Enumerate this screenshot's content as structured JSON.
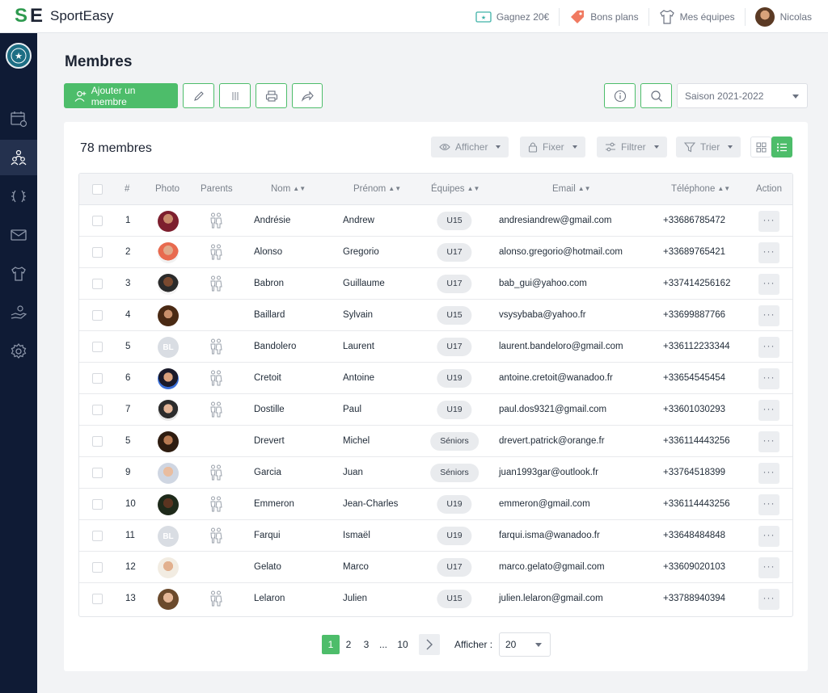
{
  "brand": {
    "name": "SportEasy"
  },
  "topbar": {
    "links": [
      {
        "label": "Gagnez 20€",
        "icon": "ticket-icon"
      },
      {
        "label": "Bons plans",
        "icon": "tag-icon"
      },
      {
        "label": "Mes équipes",
        "icon": "jersey-icon"
      }
    ],
    "user": {
      "name": "Nicolas"
    }
  },
  "sidebar": {
    "items": [
      {
        "icon": "calendar-icon",
        "active": false
      },
      {
        "icon": "members-icon",
        "active": true
      },
      {
        "icon": "laurel-icon",
        "active": false
      },
      {
        "icon": "mail-icon",
        "active": false
      },
      {
        "icon": "shirt-icon",
        "active": false
      },
      {
        "icon": "hand-coin-icon",
        "active": false
      },
      {
        "icon": "gear-icon",
        "active": false
      }
    ]
  },
  "page": {
    "title": "Membres",
    "add_label": "Ajouter un membre",
    "season": "Saison 2021-2022"
  },
  "list": {
    "count_label": "78 membres",
    "tools": {
      "show": "Afficher",
      "pin": "Fixer",
      "filter": "Filtrer",
      "sort": "Trier"
    }
  },
  "table": {
    "columns": {
      "num": "#",
      "photo": "Photo",
      "parents": "Parents",
      "nom": "Nom",
      "prenom": "Prénom",
      "equipes": "Équipes",
      "email": "Email",
      "telephone": "Téléphone",
      "action": "Action"
    },
    "rows": [
      {
        "num": "1",
        "nom": "Andrésie",
        "prenom": "Andrew",
        "equipe": "U15",
        "email": "andresiandrew@gmail.com",
        "tel": "+33686785472",
        "parents": true,
        "initials": ""
      },
      {
        "num": "2",
        "nom": "Alonso",
        "prenom": "Gregorio",
        "equipe": "U17",
        "email": "alonso.gregorio@hotmail.com",
        "tel": "+33689765421",
        "parents": true,
        "initials": ""
      },
      {
        "num": "3",
        "nom": "Babron",
        "prenom": "Guillaume",
        "equipe": "U17",
        "email": "bab_gui@yahoo.com",
        "tel": "+337414256162",
        "parents": true,
        "initials": ""
      },
      {
        "num": "4",
        "nom": "Baillard",
        "prenom": "Sylvain",
        "equipe": "U15",
        "email": "vsysybaba@yahoo.fr",
        "tel": "+33699887766",
        "parents": false,
        "initials": ""
      },
      {
        "num": "5",
        "nom": "Bandolero",
        "prenom": "Laurent",
        "equipe": "U17",
        "email": "laurent.bandeloro@gmail.com",
        "tel": "+336112233344",
        "parents": true,
        "initials": "BL"
      },
      {
        "num": "6",
        "nom": "Cretoit",
        "prenom": "Antoine",
        "equipe": "U19",
        "email": "antoine.cretoit@wanadoo.fr",
        "tel": "+33654545454",
        "parents": true,
        "initials": ""
      },
      {
        "num": "7",
        "nom": "Dostille",
        "prenom": "Paul",
        "equipe": "U19",
        "email": "paul.dos9321@gmail.com",
        "tel": "+33601030293",
        "parents": true,
        "initials": ""
      },
      {
        "num": "5",
        "nom": "Drevert",
        "prenom": "Michel",
        "equipe": "Séniors",
        "email": "drevert.patrick@orange.fr",
        "tel": "+336114443256",
        "parents": false,
        "initials": ""
      },
      {
        "num": "9",
        "nom": "Garcia",
        "prenom": "Juan",
        "equipe": "Séniors",
        "email": "juan1993gar@outlook.fr",
        "tel": "+33764518399",
        "parents": true,
        "initials": ""
      },
      {
        "num": "10",
        "nom": "Emmeron",
        "prenom": "Jean-Charles",
        "equipe": "U19",
        "email": "emmeron@gmail.com",
        "tel": "+336114443256",
        "parents": true,
        "initials": ""
      },
      {
        "num": "11",
        "nom": "Farqui",
        "prenom": "Ismaël",
        "equipe": "U19",
        "email": "farqui.isma@wanadoo.fr",
        "tel": "+33648484848",
        "parents": true,
        "initials": "BL"
      },
      {
        "num": "12",
        "nom": "Gelato",
        "prenom": "Marco",
        "equipe": "U17",
        "email": "marco.gelato@gmail.com",
        "tel": "+33609020103",
        "parents": false,
        "initials": ""
      },
      {
        "num": "13",
        "nom": "Lelaron",
        "prenom": "Julien",
        "equipe": "U15",
        "email": "julien.lelaron@gmail.com",
        "tel": "+33788940394",
        "parents": true,
        "initials": ""
      }
    ],
    "action_label": "···"
  },
  "pagination": {
    "pages": [
      "1",
      "2",
      "3",
      "...",
      "10"
    ],
    "current": "1",
    "per_page_label": "Afficher :",
    "per_page_value": "20"
  },
  "colors": {
    "accent": "#4dbd6a",
    "sidebar": "#0f1b35"
  }
}
